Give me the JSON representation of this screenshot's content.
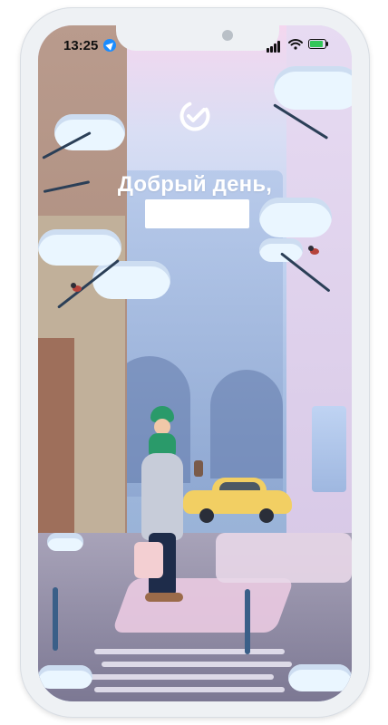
{
  "status_bar": {
    "time": "13:25",
    "icons": [
      "location-arrow-icon",
      "cellular-signal-icon",
      "wifi-icon",
      "battery-charging-icon"
    ],
    "colors": {
      "battery_fill": "#34c759",
      "location": "#1a8cff"
    }
  },
  "app": {
    "logo_icon": "sber-check-icon",
    "greeting": "Добрый день,",
    "user_name": ""
  },
  "illustration": {
    "scene": "winter-street",
    "palette": {
      "sky_top": "#f4d7ef",
      "sky_bottom": "#8fa9cc",
      "snow": "#eaf6ff",
      "accent_green": "#2a9a6a",
      "taxi_yellow": "#f2cf63"
    }
  }
}
